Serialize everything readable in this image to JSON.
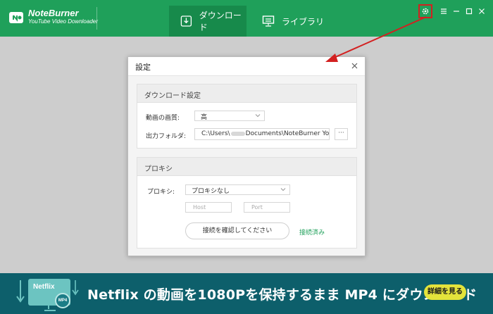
{
  "app": {
    "brand_name": "NoteBurner",
    "brand_subtitle": "YouTube Video Downloader"
  },
  "nav": {
    "tabs": [
      {
        "label": "ダウンロード",
        "icon": "download-icon",
        "active": true
      },
      {
        "label": "ライブラリ",
        "icon": "monitor-icon",
        "active": false
      }
    ]
  },
  "window_controls": [
    "settings-gear-icon",
    "menu-icon",
    "minimize-icon",
    "maximize-icon",
    "close-icon"
  ],
  "dialog": {
    "title": "設定",
    "download_section": {
      "title": "ダウンロード設定",
      "quality_label": "動画の画質:",
      "quality_value": "高",
      "folder_label": "出力フォルダ:",
      "folder_prefix": "C:\\Users\\",
      "folder_suffix": "Documents\\NoteBurner YouTu",
      "browse_label": "···"
    },
    "proxy_section": {
      "title": "プロキシ",
      "proxy_label": "プロキシ:",
      "proxy_value": "プロキシなし",
      "host_placeholder": "Host",
      "port_placeholder": "Port",
      "confirm_button": "接続を確認してください",
      "status": "接続済み"
    }
  },
  "banner": {
    "monitor_label": "Netflix",
    "badge": "MP4",
    "headline": "Netflix の動画を1080Pを保持するまま MP4 にダウンロード",
    "button": "詳細を見る"
  },
  "colors": {
    "brand_green": "#1fa05a",
    "active_tab": "#178a4b",
    "annotation_red": "#d32020",
    "banner_bg": "#0d5f6b",
    "banner_button": "#e4e33b"
  }
}
